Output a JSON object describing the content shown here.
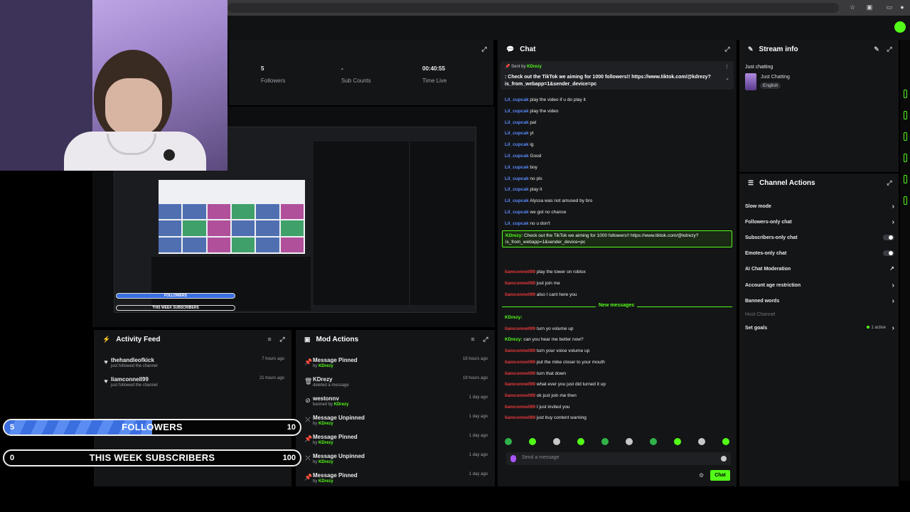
{
  "colors": {
    "accent": "#53fc18",
    "panel": "#141517",
    "followers_fill": "#3b6fe0",
    "username_red": "#e83a3a",
    "username_blue": "#5b8cff"
  },
  "stats": [
    {
      "value": "5",
      "label": "Followers"
    },
    {
      "value": "-",
      "label": "Sub Counts"
    },
    {
      "value": "00:40:55",
      "label": "Time Live"
    }
  ],
  "chat": {
    "title": "Chat",
    "pinned": {
      "sent_by_label": "Sent by",
      "sender": "KDrezy",
      "message": ": Check out the TikTok we aiming for 1000 followers!! https://www.tiktok.com/@kdrezy?is_from_webapp=1&sender_device=pc"
    },
    "messages": [
      {
        "user": "Lil_cupcak",
        "text": "play the video if u do play it",
        "color": "blue"
      },
      {
        "user": "Lil_cupcak",
        "text": "play the video",
        "color": "blue"
      },
      {
        "user": "Lil_cupcak",
        "text": "pal",
        "color": "blue"
      },
      {
        "user": "Lil_cupcak",
        "text": "yt",
        "color": "blue"
      },
      {
        "user": "Lil_cupcak",
        "text": "ig",
        "color": "blue"
      },
      {
        "user": "Lil_cupcak",
        "text": "Good",
        "color": "blue"
      },
      {
        "user": "Lil_cupcak",
        "text": "boy",
        "color": "blue"
      },
      {
        "user": "Lil_cupcak",
        "text": "no pls",
        "color": "blue"
      },
      {
        "user": "Lil_cupcak",
        "text": "play it",
        "color": "blue"
      },
      {
        "user": "Lil_cupcak",
        "text": "Alyssa was not amused by bro",
        "color": "blue"
      },
      {
        "user": "Lil_cupcak",
        "text": "we got no chance",
        "color": "blue"
      },
      {
        "user": "Lil_cupcak",
        "text": "no u don't",
        "color": "blue"
      }
    ],
    "highlight": {
      "user": "KDrezy",
      "text": ": Check out the TikTok we aiming for 1000 followers!! https://www.tiktok.com/@kdrezy?is_from_webapp=1&sender_device=pc"
    },
    "messages_after": [
      {
        "user": "liamconnell99",
        "text": "play the tower on roblox",
        "color": "red"
      },
      {
        "user": "liamconnell99",
        "text": "just join me",
        "color": "red"
      },
      {
        "user": "liamconnell99",
        "text": "also I cant here you",
        "color": "red"
      }
    ],
    "new_messages_label": "New messages",
    "messages_new": [
      {
        "user": "KDrezy:",
        "text": "",
        "color": "green"
      },
      {
        "user": "liamconnell99",
        "text": "turn yo volume up",
        "color": "red"
      },
      {
        "user": "KDrezy:",
        "text": "can you hear me better now?",
        "color": "green"
      },
      {
        "user": "liamconnell99",
        "text": "turn your voice volume up",
        "color": "red"
      },
      {
        "user": "liamconnell99",
        "text": "put the mike closer to your mouth",
        "color": "red"
      },
      {
        "user": "liamconnell99",
        "text": "turn that down",
        "color": "red"
      },
      {
        "user": "liamconnell99",
        "text": "what ever you just did turned it up",
        "color": "red"
      },
      {
        "user": "liamconnell99",
        "text": "ok just join me then",
        "color": "red"
      },
      {
        "user": "liamconnell99",
        "text": "I just invited you",
        "color": "red"
      },
      {
        "user": "liamconnell99",
        "text": "just buy content warning",
        "color": "red"
      }
    ],
    "input_placeholder": "Send a message",
    "send_label": "Chat"
  },
  "stream_info": {
    "title": "Stream info",
    "stream_title": "Just chatting",
    "category": "Just Chatting",
    "language": "English"
  },
  "channel_actions": {
    "title": "Channel Actions",
    "items": [
      {
        "label": "Slow mode",
        "control": "chevron"
      },
      {
        "label": "Followers-only chat",
        "control": "chevron"
      },
      {
        "label": "Subscribers-only chat",
        "control": "toggle"
      },
      {
        "label": "Emotes-only chat",
        "control": "toggle"
      },
      {
        "label": "AI Chat Moderation",
        "control": "external"
      },
      {
        "label": "Account age restriction",
        "control": "chevron"
      },
      {
        "label": "Banned words",
        "control": "chevron"
      },
      {
        "label": "Host Channel",
        "control": "none"
      },
      {
        "label": "Set goals",
        "control": "chevron",
        "status": "1 active"
      }
    ]
  },
  "activity_feed": {
    "title": "Activity Feed",
    "items": [
      {
        "user": "thehandleofkick",
        "action": "just followed the channel",
        "time": "7 hours ago"
      },
      {
        "user": "liamconnell99",
        "action": "just followed the channel",
        "time": "21 hours ago"
      }
    ]
  },
  "mod_actions": {
    "title": "Mod Actions",
    "items": [
      {
        "action": "Message Pinned",
        "detail_prefix": "by",
        "user": "KDrezy",
        "time": "19 hours ago",
        "icon": "pin-icon"
      },
      {
        "action": "KDrezy",
        "detail_prefix": "deleted a message",
        "user": "",
        "time": "19 hours ago",
        "icon": "trash-icon"
      },
      {
        "action": "westonnv",
        "detail_prefix": "banned by",
        "user": "KDrezy",
        "time": "1 day ago",
        "icon": "ban-icon"
      },
      {
        "action": "Message Unpinned",
        "detail_prefix": "by",
        "user": "KDrezy",
        "time": "1 day ago",
        "icon": "unpin-icon"
      },
      {
        "action": "Message Pinned",
        "detail_prefix": "by",
        "user": "KDrezy",
        "time": "1 day ago",
        "icon": "pin-icon"
      },
      {
        "action": "Message Unpinned",
        "detail_prefix": "by",
        "user": "KDrezy",
        "time": "1 day ago",
        "icon": "unpin-icon"
      },
      {
        "action": "Message Pinned",
        "detail_prefix": "by",
        "user": "KDrezy",
        "time": "1 day ago",
        "icon": "pin-icon"
      }
    ]
  },
  "goals": [
    {
      "label": "FOLLOWERS",
      "current": "5",
      "target": "10",
      "progress": 0.5
    },
    {
      "label": "THIS WEEK SUBSCRIBERS",
      "current": "0",
      "target": "100",
      "progress": 0
    }
  ],
  "preview_goals": [
    {
      "label": "FOLLOWERS",
      "target": "10"
    },
    {
      "label": "THIS WEEK SUBSCRIBERS",
      "target": "100"
    }
  ]
}
